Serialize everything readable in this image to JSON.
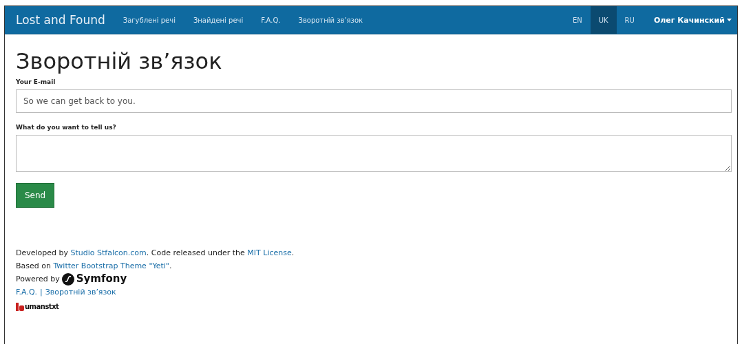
{
  "navbar": {
    "brand": "Lost and Found",
    "links": [
      {
        "label": "Загублені речі"
      },
      {
        "label": "Знайдені речі"
      },
      {
        "label": "F.A.Q."
      },
      {
        "label": "Зворотній зв’язок"
      }
    ],
    "languages": [
      {
        "label": "EN",
        "selected": false
      },
      {
        "label": "UK",
        "selected": true
      },
      {
        "label": "RU",
        "selected": false
      }
    ],
    "user": "Олег Качинский"
  },
  "page": {
    "title": "Зворотній зв’язок",
    "fields": [
      {
        "kind": "input",
        "label": "Your E-mail",
        "placeholder": "So we can get back to you."
      },
      {
        "kind": "textarea",
        "label": "What do you want to tell us?"
      }
    ],
    "submit": "Send"
  },
  "footer": {
    "lines": [
      [
        {
          "kind": "text",
          "text": "Developed by "
        },
        {
          "kind": "link",
          "text": "Studio Stfalcon.com"
        },
        {
          "kind": "text",
          "text": ". Code released under the "
        },
        {
          "kind": "link",
          "text": "MIT License"
        },
        {
          "kind": "text",
          "text": "."
        }
      ],
      [
        {
          "kind": "text",
          "text": "Based on "
        },
        {
          "kind": "link",
          "text": "Twitter Bootstrap Theme \"Yeti\""
        },
        {
          "kind": "text",
          "text": "."
        }
      ]
    ],
    "powered_by": "Powered by",
    "symfony": "Symfony",
    "links": [
      {
        "label": "F.A.Q."
      },
      {
        "label": "Зворотній зв’язок"
      }
    ],
    "separator": "|",
    "humans": "umanstxt"
  }
}
